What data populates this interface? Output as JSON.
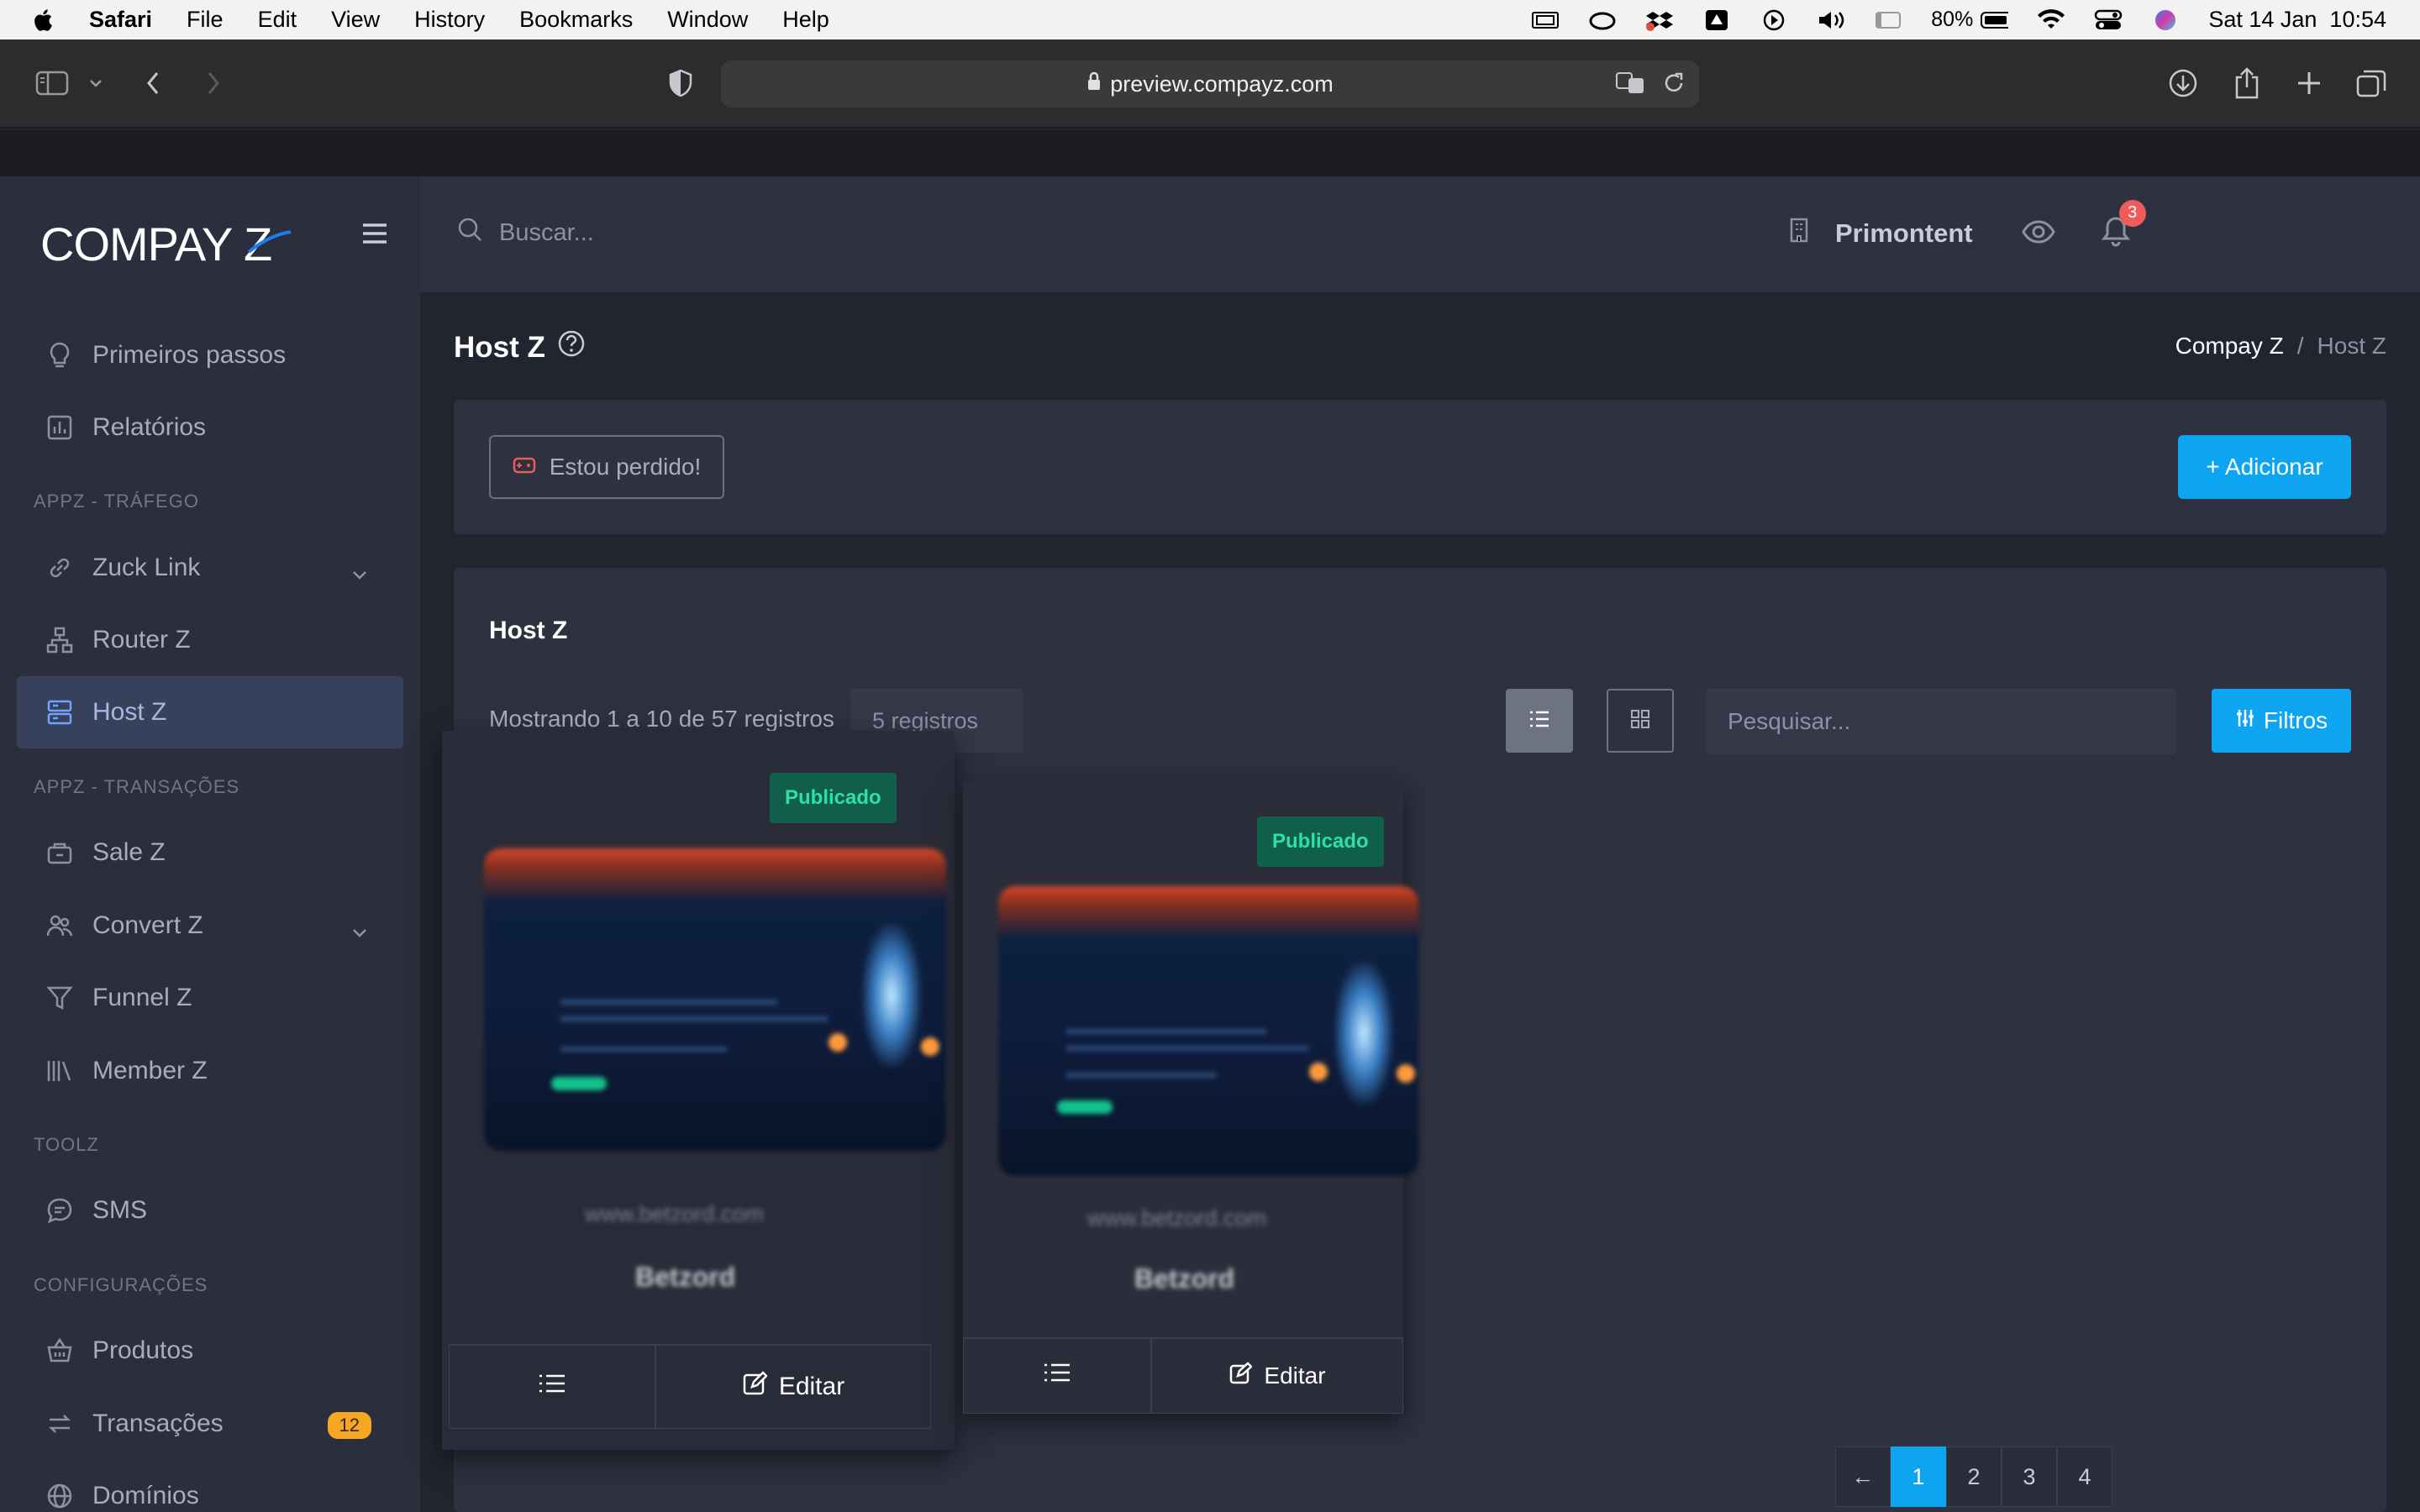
{
  "menubar": {
    "app": "Safari",
    "items": [
      "File",
      "Edit",
      "View",
      "History",
      "Bookmarks",
      "Window",
      "Help"
    ],
    "battery": "80%",
    "datetime": "Sat 14 Jan  10:54"
  },
  "browser": {
    "url": "preview.compayz.com"
  },
  "sidebar": {
    "logo": "COMPAY Z",
    "items": [
      {
        "label": "Primeiros passos",
        "icon": "lightbulb-icon"
      },
      {
        "label": "Relatórios",
        "icon": "chart-icon"
      },
      {
        "label": "Zuck Link",
        "icon": "link-icon"
      },
      {
        "label": "Router Z",
        "icon": "sitemap-icon"
      },
      {
        "label": "Host Z",
        "icon": "server-icon"
      },
      {
        "label": "Sale Z",
        "icon": "cart-icon"
      },
      {
        "label": "Convert Z",
        "icon": "users-icon"
      },
      {
        "label": "Funnel Z",
        "icon": "filter-icon"
      },
      {
        "label": "Member Z",
        "icon": "library-icon"
      },
      {
        "label": "SMS",
        "icon": "message-icon"
      },
      {
        "label": "Produtos",
        "icon": "basket-icon"
      },
      {
        "label": "Transações",
        "icon": "transfer-icon",
        "badge": "12"
      },
      {
        "label": "Domínios",
        "icon": "globe-icon"
      }
    ],
    "sections": {
      "trafego": "APPZ - TRÁFEGO",
      "transacoes": "APPZ - TRANSAÇÕES",
      "toolz": "TOOLZ",
      "config": "CONFIGURAÇÕES"
    }
  },
  "header": {
    "search_placeholder": "Buscar...",
    "store": "Primontent",
    "notifications": "3"
  },
  "page": {
    "title": "Host Z",
    "breadcrumb": [
      "Compay Z",
      "/",
      "Host Z"
    ]
  },
  "actions": {
    "lost_label": "Estou perdido!",
    "add_label": "+ Adicionar"
  },
  "list": {
    "title": "Host Z",
    "showing": "Mostrando 1 a 10 de 57 registros",
    "per_page": "5 registros",
    "search_placeholder": "Pesquisar...",
    "filters_label": "Filtros"
  },
  "sites": [
    {
      "status": "Publicado",
      "domain": "www.betzord.com",
      "name": "Betzord",
      "edit_label": "Editar"
    },
    {
      "status": "Publicado",
      "domain": "www.betzord.com",
      "name": "Betzord",
      "edit_label": "Editar"
    }
  ],
  "pagination": {
    "prev": "←",
    "pages": [
      "1",
      "2",
      "3",
      "4"
    ],
    "current": "1"
  },
  "colors": {
    "accent": "#0ea5f0",
    "published_bg": "#0f5f4a",
    "published_text": "#2ee0a6",
    "badge": "#f5a623",
    "notif": "#f05a5a"
  }
}
